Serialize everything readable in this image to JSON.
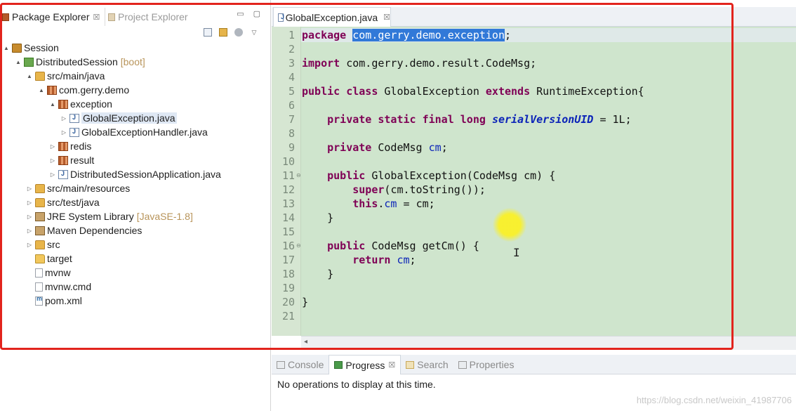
{
  "left_panel": {
    "tabs": [
      {
        "label": "Package Explorer",
        "close": "☒",
        "active": true
      },
      {
        "label": "Project Explorer",
        "active": false
      }
    ],
    "view_buttons": {
      "minimize": "▭",
      "maximize": "▢"
    },
    "tree": [
      {
        "label": "Session",
        "arrow": "▲"
      },
      {
        "label": "DistributedSession",
        "decoration": "[boot]",
        "arrow": "▲"
      },
      {
        "label": "src/main/java",
        "arrow": "▲"
      },
      {
        "label": "com.gerry.demo",
        "arrow": "▲"
      },
      {
        "label": "exception",
        "arrow": "▲"
      },
      {
        "label": "GlobalException.java",
        "arrow": "▷",
        "selected": true
      },
      {
        "label": "GlobalExceptionHandler.java",
        "arrow": "▷"
      },
      {
        "label": "redis",
        "arrow": "▷"
      },
      {
        "label": "result",
        "arrow": "▷"
      },
      {
        "label": "DistributedSessionApplication.java",
        "arrow": "▷"
      },
      {
        "label": "src/main/resources",
        "arrow": "▷"
      },
      {
        "label": "src/test/java",
        "arrow": "▷"
      },
      {
        "label": "JRE System Library",
        "decoration": "[JavaSE-1.8]",
        "arrow": "▷"
      },
      {
        "label": "Maven Dependencies",
        "arrow": "▷"
      },
      {
        "label": "src",
        "arrow": "▷"
      },
      {
        "label": "target",
        "arrow": ""
      },
      {
        "label": "mvnw",
        "arrow": ""
      },
      {
        "label": "mvnw.cmd",
        "arrow": ""
      },
      {
        "label": "pom.xml",
        "arrow": ""
      }
    ]
  },
  "editor": {
    "tab_label": "GlobalException.java",
    "tab_close": "☒",
    "line_numbers": [
      "1",
      "2",
      "3",
      "4",
      "5",
      "6",
      "7",
      "8",
      "9",
      "10",
      "11",
      "12",
      "13",
      "14",
      "15",
      "16",
      "17",
      "18",
      "19",
      "20",
      "21"
    ],
    "fold_marker": "⊖",
    "code": {
      "l1_kw": "package",
      "l1_sel": "com.gerry.demo.exception",
      "l1_end": ";",
      "l3_kw": "import",
      "l3_rest": " com.gerry.demo.result.CodeMsg;",
      "l5_kw1": "public",
      "l5_kw2": "class",
      "l5_name": " GlobalException ",
      "l5_kw3": "extends",
      "l5_rest": " RuntimeException{",
      "l7_kw": "private static final long",
      "l7_field": "serialVersionUID",
      "l7_rest": " = 1L;",
      "l9_kw": "private",
      "l9_type": " CodeMsg ",
      "l9_field": "cm",
      "l9_end": ";",
      "l11_kw": "public",
      "l11_sig": " GlobalException(CodeMsg ",
      "l11_param": "cm",
      "l11_end": ") {",
      "l12_kw": "super",
      "l12_open": "(",
      "l12_field": "cm",
      "l12_rest": ".toString());",
      "l13_kw": "this",
      "l13_dot": ".",
      "l13_field": "cm",
      "l13_eq": " = ",
      "l13_param": "cm",
      "l13_end": ";",
      "l14": "}",
      "l16_kw": "public",
      "l16_rest": " CodeMsg getCm() {",
      "l17_kw": "return",
      "l17_field": "cm",
      "l17_end": ";",
      "l18": "}",
      "l20": "}"
    },
    "scroll_arrow": "◂",
    "cursor_glyph": "I"
  },
  "bottom_panel": {
    "tabs": [
      {
        "label": "Console",
        "active": false
      },
      {
        "label": "Progress",
        "close": "☒",
        "active": true
      },
      {
        "label": "Search",
        "active": false
      },
      {
        "label": "Properties",
        "active": false
      }
    ],
    "status_text": "No operations to display at this time.",
    "watermark": "https://blog.csdn.net/weixin_41987706"
  },
  "colors": {
    "editor_background": "#cfe5cd",
    "keyword": "#7f0055",
    "field": "#0b23b8",
    "selection": "#3179d8",
    "annotation_frame": "#e2241d"
  }
}
